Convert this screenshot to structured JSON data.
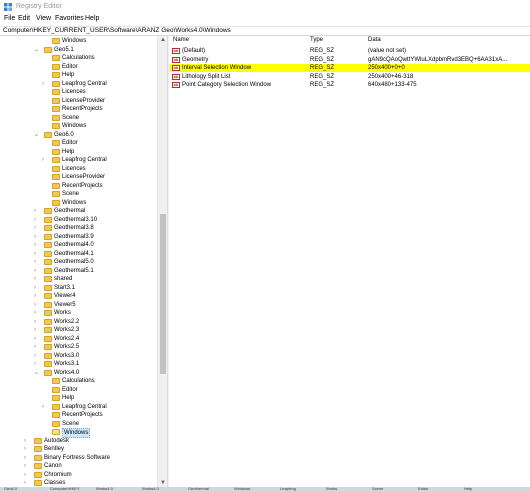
{
  "window": {
    "title": "Registry Editor"
  },
  "menu": [
    "File",
    "Edit",
    "View",
    "Favorites",
    "Help"
  ],
  "address": "Computer\\HKEY_CURRENT_USER\\Software\\ARANZ Geo\\Works4.0\\Windows",
  "columns": {
    "name": "Name",
    "type": "Type",
    "data": "Data"
  },
  "values": [
    {
      "name": "(Default)",
      "type": "REG_SZ",
      "data": "(value not set)",
      "highlight": false
    },
    {
      "name": "Geometry",
      "type": "REG_SZ",
      "data": "gAN9cQAoQwttYWluLXdpbmRvd3EBQ+6AA31xA...",
      "highlight": false
    },
    {
      "name": "Interval Selection Window",
      "type": "REG_SZ",
      "data": "250x400+0+0",
      "highlight": true
    },
    {
      "name": "Lithology Split List",
      "type": "REG_SZ",
      "data": "250x400+46-318",
      "highlight": false
    },
    {
      "name": "Point Category Selection Window",
      "type": "REG_SZ",
      "data": "640x480+133-475",
      "highlight": false
    }
  ],
  "tree": [
    {
      "label": "Windows",
      "depth": 3,
      "expander": "",
      "selected": false
    },
    {
      "label": "Geo5.1",
      "depth": 2,
      "expander": "v",
      "selected": false
    },
    {
      "label": "Calculations",
      "depth": 3,
      "expander": "",
      "selected": false
    },
    {
      "label": "Editor",
      "depth": 3,
      "expander": "",
      "selected": false
    },
    {
      "label": "Help",
      "depth": 3,
      "expander": "",
      "selected": false
    },
    {
      "label": "Leapfrog Central",
      "depth": 3,
      "expander": ">",
      "selected": false
    },
    {
      "label": "Licences",
      "depth": 3,
      "expander": "",
      "selected": false
    },
    {
      "label": "LicenseProvider",
      "depth": 3,
      "expander": "",
      "selected": false
    },
    {
      "label": "RecentProjects",
      "depth": 3,
      "expander": "",
      "selected": false
    },
    {
      "label": "Scene",
      "depth": 3,
      "expander": "",
      "selected": false
    },
    {
      "label": "Windows",
      "depth": 3,
      "expander": "",
      "selected": false
    },
    {
      "label": "Geo6.0",
      "depth": 2,
      "expander": "v",
      "selected": false
    },
    {
      "label": "Editor",
      "depth": 3,
      "expander": "",
      "selected": false
    },
    {
      "label": "Help",
      "depth": 3,
      "expander": "",
      "selected": false
    },
    {
      "label": "Leapfrog Central",
      "depth": 3,
      "expander": ">",
      "selected": false
    },
    {
      "label": "Licences",
      "depth": 3,
      "expander": "",
      "selected": false
    },
    {
      "label": "LicenseProvider",
      "depth": 3,
      "expander": "",
      "selected": false
    },
    {
      "label": "RecentProjects",
      "depth": 3,
      "expander": "",
      "selected": false
    },
    {
      "label": "Scene",
      "depth": 3,
      "expander": "",
      "selected": false
    },
    {
      "label": "Windows",
      "depth": 3,
      "expander": "",
      "selected": false
    },
    {
      "label": "Geothermal",
      "depth": 2,
      "expander": ">",
      "selected": false
    },
    {
      "label": "Geothermal3.10",
      "depth": 2,
      "expander": ">",
      "selected": false
    },
    {
      "label": "Geothermal3.8",
      "depth": 2,
      "expander": ">",
      "selected": false
    },
    {
      "label": "Geothermal3.9",
      "depth": 2,
      "expander": ">",
      "selected": false
    },
    {
      "label": "Geothermal4.0",
      "depth": 2,
      "expander": ">",
      "selected": false
    },
    {
      "label": "Geothermal4.1",
      "depth": 2,
      "expander": ">",
      "selected": false
    },
    {
      "label": "Geothermal5.0",
      "depth": 2,
      "expander": ">",
      "selected": false
    },
    {
      "label": "Geothermal5.1",
      "depth": 2,
      "expander": ">",
      "selected": false
    },
    {
      "label": "shared",
      "depth": 2,
      "expander": ">",
      "selected": false
    },
    {
      "label": "Start3.1",
      "depth": 2,
      "expander": ">",
      "selected": false
    },
    {
      "label": "Viewer4",
      "depth": 2,
      "expander": ">",
      "selected": false
    },
    {
      "label": "Viewer5",
      "depth": 2,
      "expander": ">",
      "selected": false
    },
    {
      "label": "Works",
      "depth": 2,
      "expander": ">",
      "selected": false
    },
    {
      "label": "Works2.2",
      "depth": 2,
      "expander": ">",
      "selected": false
    },
    {
      "label": "Works2.3",
      "depth": 2,
      "expander": ">",
      "selected": false
    },
    {
      "label": "Works2.4",
      "depth": 2,
      "expander": ">",
      "selected": false
    },
    {
      "label": "Works2.5",
      "depth": 2,
      "expander": ">",
      "selected": false
    },
    {
      "label": "Works3.0",
      "depth": 2,
      "expander": ">",
      "selected": false
    },
    {
      "label": "Works3.1",
      "depth": 2,
      "expander": ">",
      "selected": false
    },
    {
      "label": "Works4.0",
      "depth": 2,
      "expander": "v",
      "selected": false
    },
    {
      "label": "Calculations",
      "depth": 3,
      "expander": "",
      "selected": false
    },
    {
      "label": "Editor",
      "depth": 3,
      "expander": "",
      "selected": false
    },
    {
      "label": "Help",
      "depth": 3,
      "expander": "",
      "selected": false
    },
    {
      "label": "Leapfrog Central",
      "depth": 3,
      "expander": ">",
      "selected": false
    },
    {
      "label": "RecentProjects",
      "depth": 3,
      "expander": "",
      "selected": false
    },
    {
      "label": "Scene",
      "depth": 3,
      "expander": "",
      "selected": false
    },
    {
      "label": "Windows",
      "depth": 3,
      "expander": "",
      "selected": true
    },
    {
      "label": "Autodesk",
      "depth": 1,
      "expander": ">",
      "selected": false
    },
    {
      "label": "Bentley",
      "depth": 1,
      "expander": ">",
      "selected": false
    },
    {
      "label": "Binary Fortress Software",
      "depth": 1,
      "expander": ">",
      "selected": false
    },
    {
      "label": "Canon",
      "depth": 1,
      "expander": ">",
      "selected": false
    },
    {
      "label": "Chromium",
      "depth": 1,
      "expander": ">",
      "selected": false
    },
    {
      "label": "Classes",
      "depth": 1,
      "expander": ">",
      "selected": false
    }
  ],
  "taskbar": [
    "Geo6.0",
    "Computer\\HKEY",
    "Works4.0",
    "Works4.0",
    "Geothermal",
    "Windows",
    "Leapfrog",
    "Works",
    "Scene",
    "Editor",
    "Help"
  ],
  "colors": {
    "highlight": "#ffff00",
    "selection": "#cce8ff",
    "folder": "#f2c94c"
  }
}
